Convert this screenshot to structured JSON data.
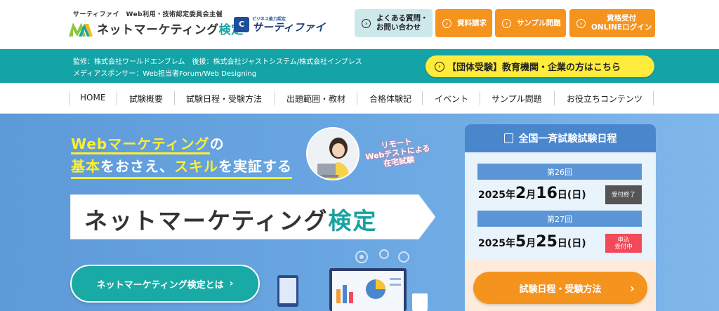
{
  "header": {
    "organizer": "サーティファイ　Web利用・技術認定委員会主催",
    "logo_title": "ネットマーケティング",
    "logo_kentei": "検定",
    "partner_small": "ビジネス能力認定",
    "partner_name": "サーティファイ",
    "faq_line1": "よくある質問・",
    "faq_line2": "お問い合わせ",
    "doc_label": "資料請求",
    "sample_label": "サンプル問題",
    "login_line1": "資格受付",
    "login_line2": "ONLINEログイン"
  },
  "band": {
    "line1": "監修：株式会社ワールドエンブレム　後援：株式会社ジャストシステム/株式会社インプレス",
    "line2": "メディアスポンサー：Web担当者Forum/Web Designing",
    "group_button": "【団体受験】教育機関・企業の方はこちら"
  },
  "nav": {
    "items": [
      "HOME",
      "試験概要",
      "試験日程・受験方法",
      "出題範囲・教材",
      "合格体験記",
      "イベント",
      "サンプル問題",
      "お役立ちコンテンツ"
    ]
  },
  "hero": {
    "line1_a": "Webマーケティング",
    "line1_b": "の",
    "line2_a": "基本",
    "line2_b": "をおさえ、",
    "line2_c": "スキル",
    "line2_d": "を実証する",
    "remote_1": "リモート",
    "remote_2": "Webテストによる",
    "remote_3": "在宅試験",
    "banner_main": "ネットマーケティング",
    "banner_kentei": "検定",
    "about_button": "ネットマーケティング検定とは"
  },
  "schedule": {
    "title": "全国一斉試験試験日程",
    "rounds": [
      {
        "round": "第26回",
        "year": "2025",
        "y_unit": "年",
        "month": "2",
        "m_unit": "月",
        "day": "16",
        "d_unit": "日",
        "weekday": "(日)",
        "status_1": "受付終了",
        "status_2": ""
      },
      {
        "round": "第27回",
        "year": "2025",
        "y_unit": "年",
        "month": "5",
        "m_unit": "月",
        "day": "25",
        "d_unit": "日",
        "weekday": "(日)",
        "status_1": "申込",
        "status_2": "受付中"
      }
    ],
    "button": "試験日程・受験方法"
  },
  "colors": {
    "teal": "#14a3a6",
    "orange": "#f5931f",
    "yellow": "#ffeb3b",
    "blue": "#4a86cc",
    "red": "#f24a5a"
  }
}
